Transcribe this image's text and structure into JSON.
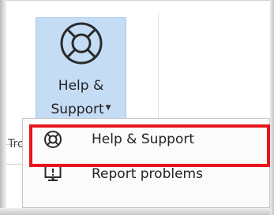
{
  "ribbon": {
    "button": {
      "icon": "lifebuoy-icon",
      "label_line1": "Help &",
      "label_line2": "Support",
      "dropdown_icon": "dropdown-arrow-icon"
    },
    "group_label": "Tro"
  },
  "menu": {
    "items": [
      {
        "label": "Help & Support",
        "icon": "lifebuoy-icon",
        "highlighted": true
      },
      {
        "label": "Report problems",
        "icon": "monitor-warning-icon",
        "highlighted": false
      }
    ]
  },
  "colors": {
    "button_bg": "#c5dcf5",
    "highlight_border": "#e8141c",
    "menu_bg": "#fbfbfb",
    "text": "#222222"
  }
}
